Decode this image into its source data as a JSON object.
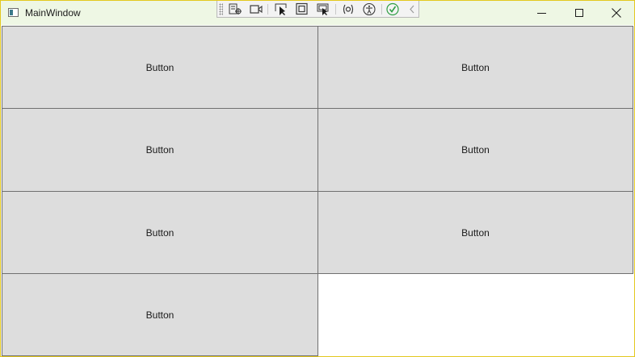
{
  "window": {
    "title": "MainWindow"
  },
  "toolbar": {
    "icons": [
      "select-in-tree-icon",
      "record-icon",
      "select-element-icon",
      "display-layout-adorners-icon",
      "track-focused-element-icon",
      "binding-failures-icon",
      "accessibility-icon",
      "app-running-check-icon",
      "collapse-toolbar-icon"
    ]
  },
  "buttons": [
    {
      "label": "Button"
    },
    {
      "label": "Button"
    },
    {
      "label": "Button"
    },
    {
      "label": "Button"
    },
    {
      "label": "Button"
    },
    {
      "label": "Button"
    },
    {
      "label": "Button"
    }
  ],
  "colors": {
    "titlebar_bg": "#eef7e4",
    "window_border": "#e3c81e",
    "button_bg": "#dddddd",
    "button_border": "#707070"
  }
}
